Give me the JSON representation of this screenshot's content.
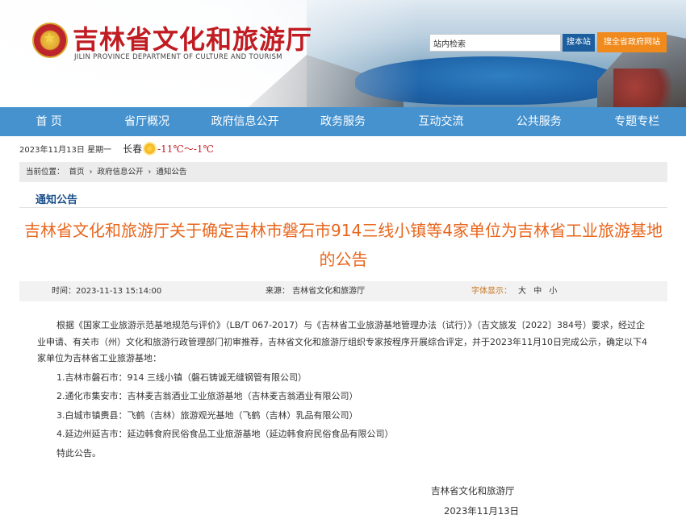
{
  "header": {
    "site_title": "吉林省文化和旅游厅",
    "site_subtitle": "JILIN PROVINCE DEPARTMENT OF CULTURE AND TOURISM",
    "search_placeholder": "站内检索",
    "search_button": "搜本站",
    "gov_button": "搜全省政府网站"
  },
  "nav": {
    "items": [
      "首 页",
      "省厅概况",
      "政府信息公开",
      "政务服务",
      "互动交流",
      "公共服务",
      "专题专栏"
    ]
  },
  "dateline": {
    "date": "2023年11月13日 星期一",
    "city": "长春",
    "weather_icon": "sun-icon",
    "temperature": "-11℃～-1℃"
  },
  "breadcrumb": {
    "items": [
      "当前位置：",
      "首页",
      "›",
      "政府信息公开",
      "›",
      "通知公告"
    ]
  },
  "section_title": "通知公告",
  "article": {
    "title": "吉林省文化和旅游厅关于确定吉林市磐石市914三线小镇等4家单位为吉林省工业旅游基地的公告",
    "time": "时间：2023-11-13 15:14:00",
    "source": "来源：  吉林省文化和旅游厅",
    "font_label": "字体显示：",
    "font_sizes": [
      "大",
      "中",
      "小"
    ],
    "paragraph": "根据《国家工业旅游示范基地规范与评价》（LB/T 067-2017）与《吉林省工业旅游基地管理办法（试行）》（吉文旅发〔2022〕384号）要求，经过企业申请、有关市（州）文化和旅游行政管理部门初审推荐，吉林省文化和旅游厅组织专家按程序开展综合评定，并于2023年11月10日完成公示，确定以下4家单位为吉林省工业旅游基地：",
    "items": [
      "1.吉林市磐石市：914 三线小镇（磐石铸诚无缝钢管有限公司）",
      "2.通化市集安市：吉林麦吉翁酒业工业旅游基地（吉林麦吉翁酒业有限公司）",
      "3.白城市镇赉县：飞鹤（吉林）旅游观光基地（飞鹤（吉林）乳品有限公司）",
      "4.延边州延吉市：延边韩食府民俗食品工业旅游基地（延边韩食府民俗食品有限公司）"
    ],
    "closing": "特此公告。",
    "signature": "吉林省文化和旅游厅",
    "sign_date": "2023年11月13日"
  },
  "colors": {
    "nav_bg": "#4592cf",
    "title_red": "#c01c22",
    "article_title_orange": "#e8661d",
    "search_btn": "#1c5e9e",
    "gov_btn": "#f08a1c"
  }
}
